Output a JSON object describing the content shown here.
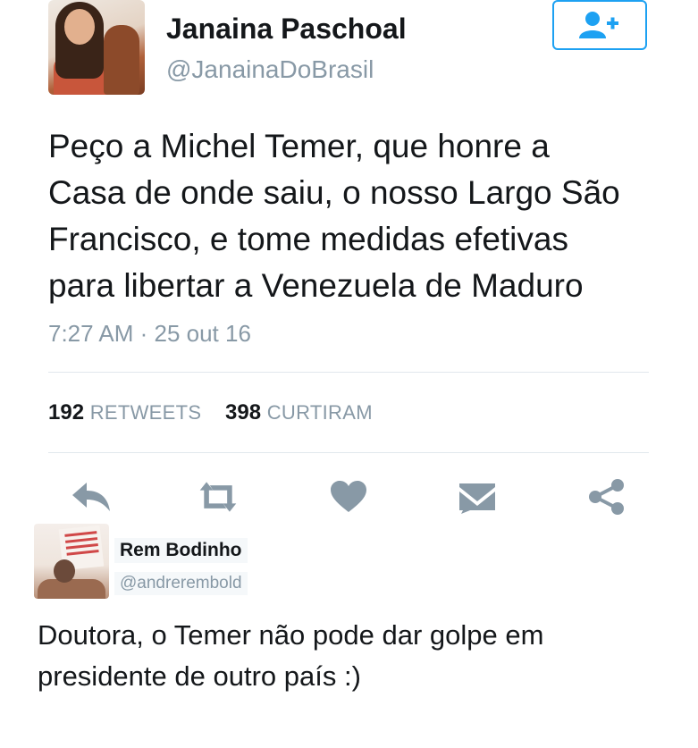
{
  "tweet": {
    "author": {
      "name": "Janaina Paschoal",
      "handle": "@JanainaDoBrasil"
    },
    "follow_button_icon": "follow-user-plus-icon",
    "text": "Peço a Michel Temer, que honre a\nCasa de onde saiu, o nosso Largo São\nFrancisco, e tome medidas efetivas\npara libertar a Venezuela de Maduro",
    "timestamp": "7:27 AM · 25 out 16",
    "stats": {
      "retweets_count": "192",
      "retweets_label": "RETWEETS",
      "likes_count": "398",
      "likes_label": "CURTIRAM"
    },
    "actions": [
      {
        "icon": "reply-icon"
      },
      {
        "icon": "retweet-icon"
      },
      {
        "icon": "heart-icon"
      },
      {
        "icon": "envelope-icon"
      },
      {
        "icon": "share-icon"
      }
    ]
  },
  "reply": {
    "author": {
      "name": "Rem Bodinho",
      "handle": "@andrerembold"
    },
    "text": "Doutora, o Temer não pode dar golpe em\npresidente de outro país :)"
  },
  "colors": {
    "accent": "#1da1f2",
    "icon_gray": "#8899a6",
    "text": "#14171a",
    "divider": "#e1e8ed"
  }
}
